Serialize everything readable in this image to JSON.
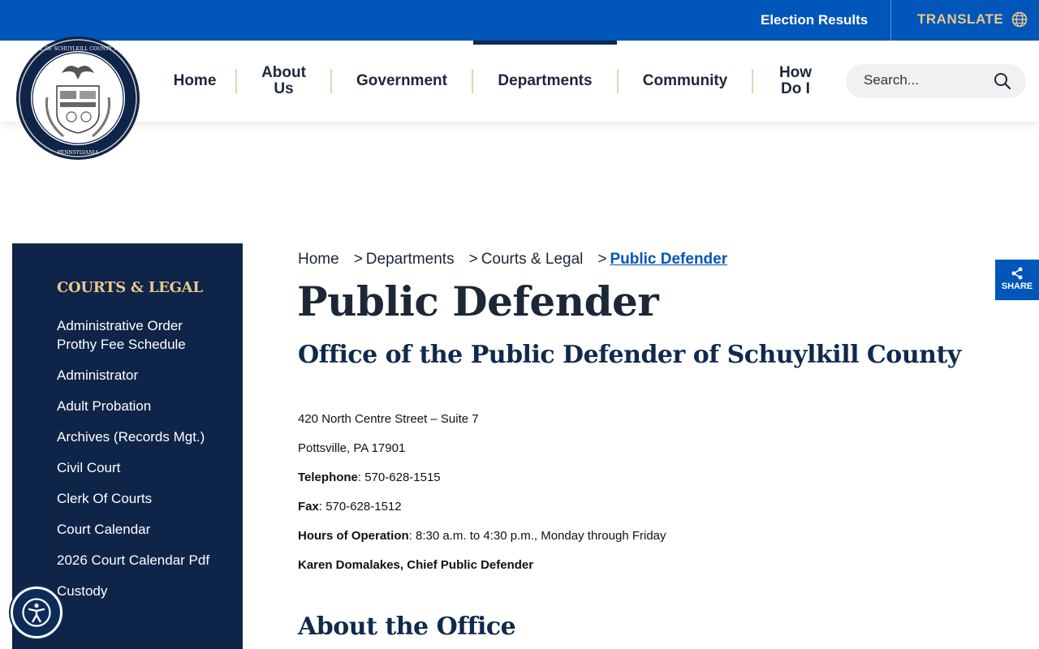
{
  "topbar": {
    "election_label": "Election Results",
    "translate_label": "TRANSLATE",
    "translate_icon": "globe-icon"
  },
  "header": {
    "seal_text_top": "SEAL OF SCHUYLKILL COUNTY 1811",
    "seal_text_bottom": "PENNSYLVANIA",
    "nav": [
      {
        "label": "Home"
      },
      {
        "label": "About Us"
      },
      {
        "label": "Government"
      },
      {
        "label": "Departments",
        "active": true
      },
      {
        "label": "Community"
      },
      {
        "label": "How Do I"
      }
    ],
    "search_placeholder": "Search...",
    "search_icon": "search-icon"
  },
  "sidebar": {
    "title": "COURTS & LEGAL",
    "items": [
      {
        "label": "Administrative Order Prothy Fee Schedule"
      },
      {
        "label": "Administrator"
      },
      {
        "label": "Adult Probation"
      },
      {
        "label": "Archives (Records Mgt.)"
      },
      {
        "label": "Civil Court"
      },
      {
        "label": "Clerk Of Courts"
      },
      {
        "label": "Court Calendar"
      },
      {
        "label": "2026 Court Calendar Pdf"
      },
      {
        "label": "Custody"
      }
    ]
  },
  "breadcrumb": {
    "items": [
      "Home",
      "Departments",
      "Courts & Legal"
    ],
    "separator": ">",
    "current": "Public Defender"
  },
  "main": {
    "title": "Public Defender",
    "subtitle": "Office of the Public Defender of Schuylkill County",
    "address_line1": "420 North Centre Street – Suite 7",
    "address_line2": "Pottsville, PA 17901",
    "telephone_label": "Telephone",
    "telephone": ": 570-628-1515",
    "fax_label": "Fax",
    "fax": ": 570-628-1512",
    "hours_label": "Hours of Operation",
    "hours": ":  8:30 a.m. to 4:30 p.m., Monday through Friday",
    "chief": "Karen Domalakes, Chief Public Defender",
    "about_heading": "About the Office"
  },
  "share": {
    "label": "SHARE",
    "icon": "share-icon"
  },
  "accessibility": {
    "icon": "accessibility-icon"
  },
  "colors": {
    "topbar_blue": "#0056b9",
    "navy": "#0f2449",
    "gold": "#e8c88a",
    "link_blue": "#0056b9"
  }
}
